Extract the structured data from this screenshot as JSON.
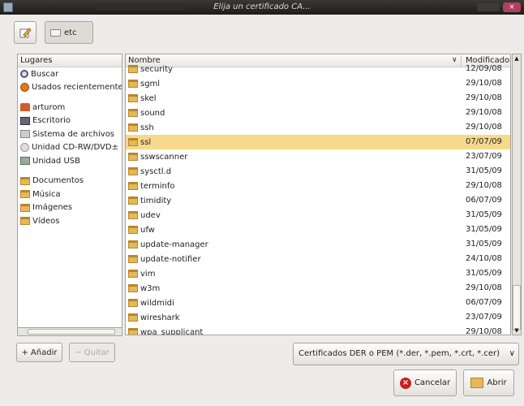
{
  "window": {
    "title": "Elija un certificado CA..."
  },
  "toolbar": {
    "path_label": "etc"
  },
  "places": {
    "header": "Lugares",
    "system_items": [
      {
        "label": "Buscar",
        "icon": "search-icon"
      },
      {
        "label": "Usados recientemente",
        "icon": "recent-icon"
      }
    ],
    "device_items": [
      {
        "label": "arturom",
        "icon": "home-folder-icon"
      },
      {
        "label": "Escritorio",
        "icon": "desktop-icon"
      },
      {
        "label": "Sistema de archivos",
        "icon": "hard-disk-icon"
      },
      {
        "label": "Unidad CD-RW/DVD±",
        "icon": "cd-drive-icon"
      },
      {
        "label": "Unidad USB",
        "icon": "usb-drive-icon"
      }
    ],
    "bookmark_items": [
      {
        "label": "Documentos",
        "icon": "folder-icon"
      },
      {
        "label": "Música",
        "icon": "folder-icon"
      },
      {
        "label": "Imágenes",
        "icon": "folder-icon"
      },
      {
        "label": "Vídeos",
        "icon": "folder-icon"
      }
    ]
  },
  "files": {
    "col_name": "Nombre",
    "col_modified": "Modificado",
    "rows": [
      {
        "name": "security",
        "modified": "12/09/08"
      },
      {
        "name": "sgml",
        "modified": "29/10/08"
      },
      {
        "name": "skel",
        "modified": "29/10/08"
      },
      {
        "name": "sound",
        "modified": "29/10/08"
      },
      {
        "name": "ssh",
        "modified": "29/10/08"
      },
      {
        "name": "ssl",
        "modified": "07/07/09"
      },
      {
        "name": "sswscanner",
        "modified": "23/07/09"
      },
      {
        "name": "sysctl.d",
        "modified": "31/05/09"
      },
      {
        "name": "terminfo",
        "modified": "29/10/08"
      },
      {
        "name": "timidity",
        "modified": "06/07/09"
      },
      {
        "name": "udev",
        "modified": "31/05/09"
      },
      {
        "name": "ufw",
        "modified": "31/05/09"
      },
      {
        "name": "update-manager",
        "modified": "31/05/09"
      },
      {
        "name": "update-notifier",
        "modified": "24/10/08"
      },
      {
        "name": "vim",
        "modified": "31/05/09"
      },
      {
        "name": "w3m",
        "modified": "29/10/08"
      },
      {
        "name": "wildmidi",
        "modified": "06/07/09"
      },
      {
        "name": "wireshark",
        "modified": "23/07/09"
      },
      {
        "name": "wpa_supplicant",
        "modified": "29/10/08"
      }
    ]
  },
  "buttons": {
    "add": "Añadir",
    "remove": "Quitar",
    "cancel": "Cancelar",
    "open": "Abrir"
  },
  "filter": {
    "selected": "Certificados DER o PEM (*.der, *.pem, *.crt, *.cer)"
  },
  "colors": {
    "selection": "#f7d98c",
    "folder": "#e5b859",
    "titlebar": "#2b2927"
  }
}
